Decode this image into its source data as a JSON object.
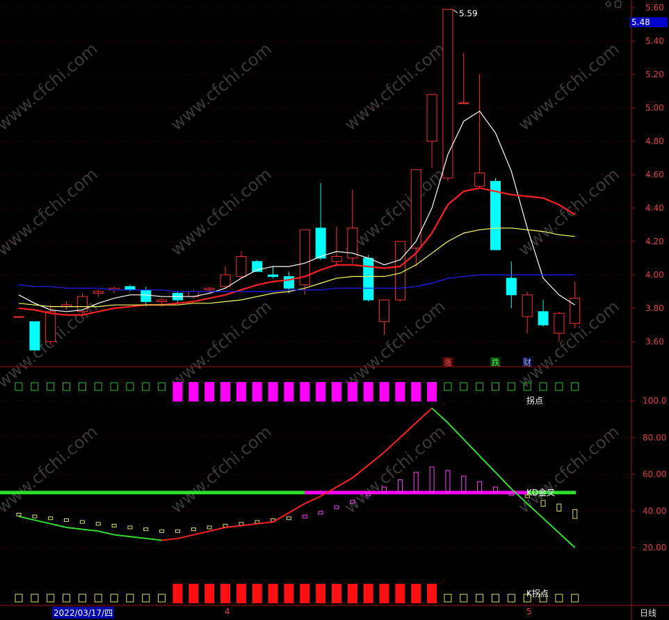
{
  "chart_data": [
    {
      "type": "candlestick",
      "title": "",
      "y_axis": {
        "min": 3.6,
        "max": 5.6,
        "ticks": [
          "5.60",
          "5.40",
          "5.20",
          "5.00",
          "4.80",
          "4.60",
          "4.40",
          "4.20",
          "4.00",
          "3.80",
          "3.60"
        ]
      },
      "current_price_label": "5.48",
      "high_annotation": "5.59",
      "candles": [
        {
          "o": 3.75,
          "h": 3.75,
          "l": 3.74,
          "c": 3.75
        },
        {
          "o": 3.72,
          "h": 3.72,
          "l": 3.55,
          "c": 3.55
        },
        {
          "o": 3.6,
          "h": 3.82,
          "l": 3.58,
          "c": 3.78
        },
        {
          "o": 3.81,
          "h": 3.84,
          "l": 3.79,
          "c": 3.82
        },
        {
          "o": 3.78,
          "h": 3.89,
          "l": 3.76,
          "c": 3.87
        },
        {
          "o": 3.89,
          "h": 3.91,
          "l": 3.87,
          "c": 3.9
        },
        {
          "o": 3.91,
          "h": 3.93,
          "l": 3.89,
          "c": 3.92
        },
        {
          "o": 3.93,
          "h": 3.94,
          "l": 3.9,
          "c": 3.91
        },
        {
          "o": 3.91,
          "h": 3.93,
          "l": 3.81,
          "c": 3.84
        },
        {
          "o": 3.84,
          "h": 3.86,
          "l": 3.81,
          "c": 3.85
        },
        {
          "o": 3.89,
          "h": 3.9,
          "l": 3.83,
          "c": 3.85
        },
        {
          "o": 3.87,
          "h": 3.91,
          "l": 3.86,
          "c": 3.9
        },
        {
          "o": 3.91,
          "h": 3.93,
          "l": 3.89,
          "c": 3.92
        },
        {
          "o": 3.93,
          "h": 4.05,
          "l": 3.92,
          "c": 4.0
        },
        {
          "o": 3.99,
          "h": 4.14,
          "l": 3.98,
          "c": 4.11
        },
        {
          "o": 4.08,
          "h": 4.09,
          "l": 4.02,
          "c": 4.02
        },
        {
          "o": 4.0,
          "h": 4.05,
          "l": 3.98,
          "c": 3.99
        },
        {
          "o": 3.99,
          "h": 4.02,
          "l": 3.89,
          "c": 3.92
        },
        {
          "o": 3.94,
          "h": 4.27,
          "l": 3.88,
          "c": 4.27
        },
        {
          "o": 4.28,
          "h": 4.55,
          "l": 4.09,
          "c": 4.1
        },
        {
          "o": 4.08,
          "h": 4.29,
          "l": 4.05,
          "c": 4.11
        },
        {
          "o": 4.1,
          "h": 4.51,
          "l": 4.07,
          "c": 4.28
        },
        {
          "o": 4.1,
          "h": 4.12,
          "l": 3.84,
          "c": 3.85
        },
        {
          "o": 3.72,
          "h": 3.85,
          "l": 3.64,
          "c": 3.85
        },
        {
          "o": 3.85,
          "h": 4.2,
          "l": 3.84,
          "c": 4.2
        },
        {
          "o": 4.16,
          "h": 4.63,
          "l": 4.05,
          "c": 4.63
        },
        {
          "o": 4.8,
          "h": 5.08,
          "l": 4.64,
          "c": 5.08
        },
        {
          "o": 4.58,
          "h": 5.59,
          "l": 4.56,
          "c": 5.59
        },
        {
          "o": 5.03,
          "h": 5.33,
          "l": 5.03,
          "c": 5.03
        },
        {
          "o": 4.53,
          "h": 5.2,
          "l": 4.52,
          "c": 4.61
        },
        {
          "o": 4.56,
          "h": 4.58,
          "l": 4.15,
          "c": 4.15
        },
        {
          "o": 3.98,
          "h": 4.08,
          "l": 3.8,
          "c": 3.88
        },
        {
          "o": 3.75,
          "h": 3.9,
          "l": 3.65,
          "c": 3.88
        },
        {
          "o": 3.78,
          "h": 3.85,
          "l": 3.69,
          "c": 3.7
        },
        {
          "o": 3.65,
          "h": 3.78,
          "l": 3.6,
          "c": 3.77
        },
        {
          "o": 3.71,
          "h": 3.96,
          "l": 3.68,
          "c": 3.86
        }
      ],
      "moving_averages": [
        {
          "color": "#ffffff",
          "values": [
            3.88,
            3.83,
            3.79,
            3.78,
            3.79,
            3.83,
            3.86,
            3.88,
            3.88,
            3.87,
            3.87,
            3.87,
            3.89,
            3.92,
            3.98,
            4.03,
            4.05,
            4.05,
            4.07,
            4.11,
            4.14,
            4.13,
            4.1,
            4.06,
            4.09,
            4.2,
            4.4,
            4.72,
            4.92,
            4.98,
            4.85,
            4.62,
            4.28,
            3.98,
            3.88,
            3.82
          ]
        },
        {
          "color": "#ff2020",
          "values": [
            3.8,
            3.79,
            3.77,
            3.76,
            3.76,
            3.78,
            3.8,
            3.81,
            3.82,
            3.82,
            3.83,
            3.84,
            3.86,
            3.88,
            3.91,
            3.94,
            3.96,
            3.97,
            3.99,
            4.03,
            4.06,
            4.06,
            4.05,
            4.04,
            4.05,
            4.13,
            4.25,
            4.42,
            4.5,
            4.52,
            4.5,
            4.48,
            4.47,
            4.46,
            4.42,
            4.36
          ]
        },
        {
          "color": "#ffff60",
          "values": [
            3.83,
            3.82,
            3.81,
            3.81,
            3.81,
            3.81,
            3.82,
            3.82,
            3.82,
            3.82,
            3.82,
            3.83,
            3.83,
            3.84,
            3.85,
            3.87,
            3.89,
            3.9,
            3.92,
            3.95,
            3.98,
            3.99,
            3.99,
            3.99,
            4.01,
            4.06,
            4.13,
            4.2,
            4.25,
            4.27,
            4.28,
            4.28,
            4.27,
            4.26,
            4.24,
            4.23
          ]
        },
        {
          "color": "#2020ff",
          "values": [
            3.94,
            3.93,
            3.93,
            3.92,
            3.92,
            3.92,
            3.91,
            3.91,
            3.91,
            3.91,
            3.9,
            3.9,
            3.9,
            3.9,
            3.9,
            3.9,
            3.9,
            3.91,
            3.91,
            3.91,
            3.92,
            3.92,
            3.92,
            3.92,
            3.92,
            3.93,
            3.95,
            3.98,
            3.99,
            4.0,
            4.0,
            4.0,
            4.0,
            4.0,
            4.0,
            4.0
          ]
        }
      ],
      "event_markers": [
        {
          "index": 27,
          "label": "涨",
          "color": "#ff5050",
          "bg": "#400000"
        },
        {
          "index": 30,
          "label": "跌",
          "color": "#40ff40",
          "bg": "#003000"
        },
        {
          "index": 32,
          "label": "财",
          "color": "#a0c0ff",
          "bg": "#000030"
        }
      ]
    },
    {
      "type": "indicator",
      "y_axis": {
        "ticks": [
          "100.0",
          "80.00",
          "60.00",
          "40.00",
          "20.00"
        ],
        "min": 0,
        "max": 110
      },
      "top_signal_label": "拐点",
      "top_signals": [
        "o",
        "o",
        "o",
        "o",
        "o",
        "o",
        "o",
        "o",
        "o",
        "o",
        "f",
        "f",
        "f",
        "f",
        "f",
        "f",
        "f",
        "f",
        "f",
        "f",
        "f",
        "f",
        "f",
        "f",
        "f",
        "f",
        "f",
        "o",
        "o",
        "o",
        "o",
        "o",
        "o",
        "o",
        "o",
        "o"
      ],
      "kd_label": "KD金叉",
      "kd_line_value": 50,
      "kd_line_magenta_from": 18,
      "kd_line_magenta_to": 32,
      "bars": [
        38,
        37,
        36,
        35,
        34,
        33,
        32,
        31,
        30,
        29,
        29,
        30,
        31,
        32,
        33,
        34,
        35,
        36,
        37,
        39,
        42,
        45,
        49,
        53,
        57,
        61,
        64,
        62,
        59,
        56,
        53,
        50,
        48,
        45,
        43,
        40
      ],
      "k_line": [
        37,
        35,
        33,
        31,
        30,
        29,
        27,
        26,
        25,
        24,
        25,
        27,
        29,
        31,
        32,
        33,
        34,
        39,
        44,
        48,
        53,
        58,
        65,
        72,
        80,
        88,
        96,
        88,
        79,
        70,
        61,
        52,
        44,
        36,
        28,
        20
      ],
      "bottom_signal_label": "K拐点",
      "bottom_signals": [
        "o",
        "o",
        "o",
        "o",
        "o",
        "o",
        "o",
        "o",
        "o",
        "o",
        "r",
        "r",
        "r",
        "r",
        "r",
        "r",
        "r",
        "r",
        "r",
        "r",
        "r",
        "r",
        "r",
        "r",
        "r",
        "r",
        "r",
        "o",
        "o",
        "o",
        "o",
        "o",
        "o",
        "o",
        "o",
        "o"
      ]
    }
  ],
  "x_axis": {
    "date_label": "2022/03/17/四",
    "month_labels": [
      "4",
      "5"
    ]
  },
  "period_label": "日线",
  "watermark": "www.cfchi.com",
  "top_icons": "◇ ▢"
}
